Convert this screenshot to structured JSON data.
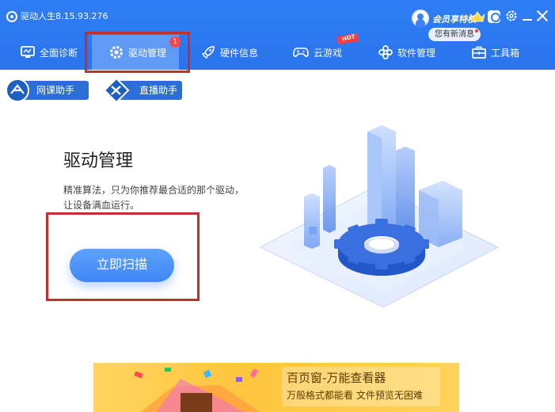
{
  "app": {
    "title": "驱动人生8.15.93.276"
  },
  "header": {
    "vip_text": "会员享特权",
    "message_bubble": "您有新消息"
  },
  "tabs": [
    {
      "label": "全面诊断",
      "icon": "monitor-icon"
    },
    {
      "label": "驱动管理",
      "icon": "gear-icon",
      "badge": "1",
      "active": true
    },
    {
      "label": "硬件信息",
      "icon": "rocket-icon"
    },
    {
      "label": "云游戏",
      "icon": "gamepad-icon",
      "tag": "HOT"
    },
    {
      "label": "软件管理",
      "icon": "apps-icon"
    },
    {
      "label": "工具箱",
      "icon": "toolbox-icon"
    }
  ],
  "helpers": [
    {
      "label": "网课助手",
      "icon": "online-class-icon"
    },
    {
      "label": "直播助手",
      "icon": "live-stream-icon"
    }
  ],
  "main": {
    "title": "驱动管理",
    "description_line1": "精准算法，只为你推荐最合适的那个驱动，",
    "description_line2": "让设备满血运行。",
    "scan_button": "立即扫描"
  },
  "ad": {
    "title": "百页窗-万能查看器",
    "subtitle": "万般格式都能看  文件预览无困难"
  },
  "colors": {
    "header_bg": "#2f7df4",
    "active_tab_bg": "#5f9bf6",
    "scan_button": "#4a8ef8",
    "badge": "#ff4545",
    "annotation_red": "#c12f2f",
    "ad_bg": "#ffc53d"
  }
}
